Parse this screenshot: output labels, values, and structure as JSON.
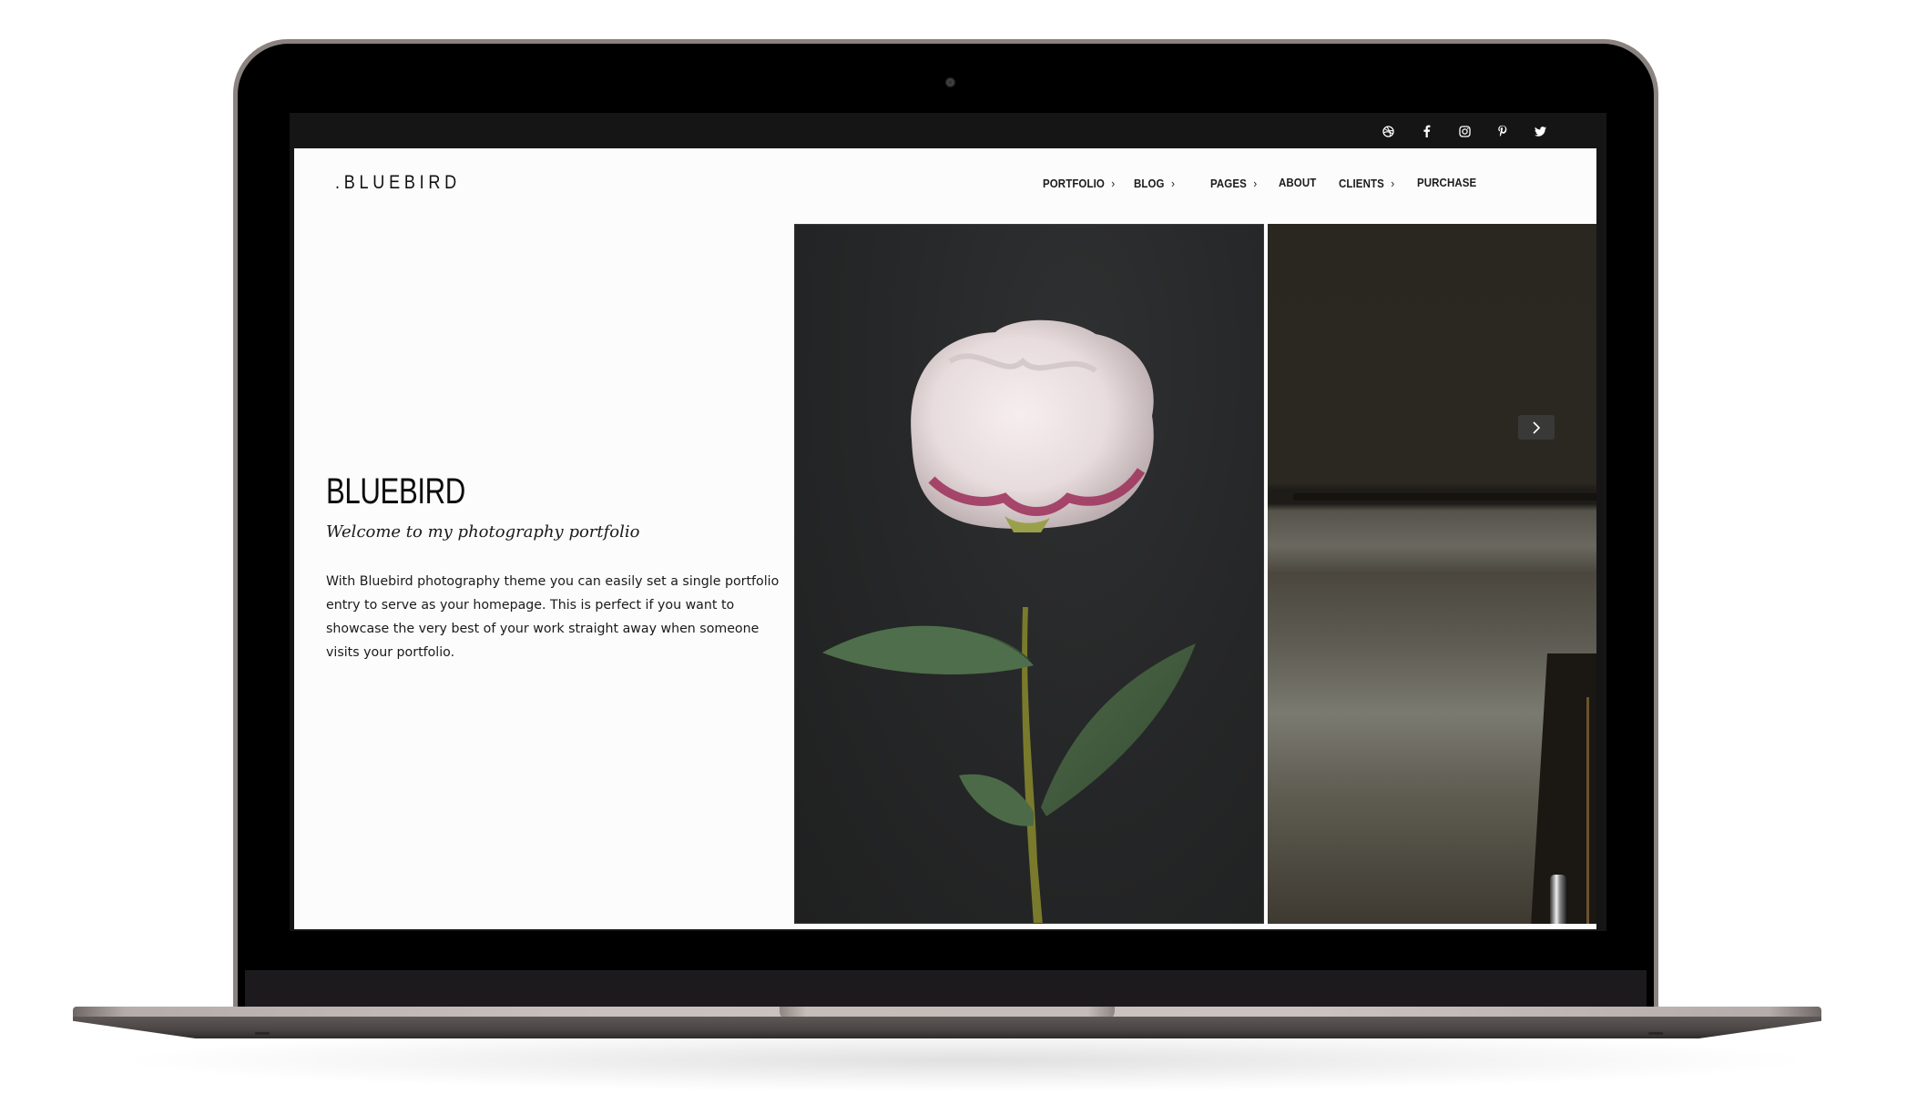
{
  "site": {
    "logo": ".BLUEBIRD",
    "social_icons": [
      "dribbble-icon",
      "facebook-icon",
      "instagram-icon",
      "pinterest-icon",
      "twitter-icon"
    ]
  },
  "nav": {
    "items": [
      {
        "label": "PORTFOLIO",
        "has_submenu": true
      },
      {
        "label": "BLOG",
        "has_submenu": true
      },
      {
        "label": "PAGES",
        "has_submenu": true
      },
      {
        "label": "ABOUT",
        "has_submenu": false
      },
      {
        "label": "CLIENTS",
        "has_submenu": true
      },
      {
        "label": "PURCHASE",
        "has_submenu": false
      }
    ],
    "submenu_glyph": "›"
  },
  "hero": {
    "title": "BLUEBIRD",
    "subtitle": "Welcome to my photography portfolio",
    "body": "With Bluebird photography theme you can easily set a single portfolio entry to serve as your homepage. This is perfect if you want to showcase the very best of your work straight away when someone visits your portfolio."
  },
  "gallery": {
    "images": [
      {
        "description": "white peony with green leaves on dark background"
      },
      {
        "description": "dim interior wall with shelf and framed picture"
      }
    ],
    "next_label": "›"
  },
  "colors": {
    "page_bg": "#fcfcfc",
    "topbar_bg": "#151515",
    "text": "#1a1a1a",
    "laptop_frame": "#8b8380"
  }
}
